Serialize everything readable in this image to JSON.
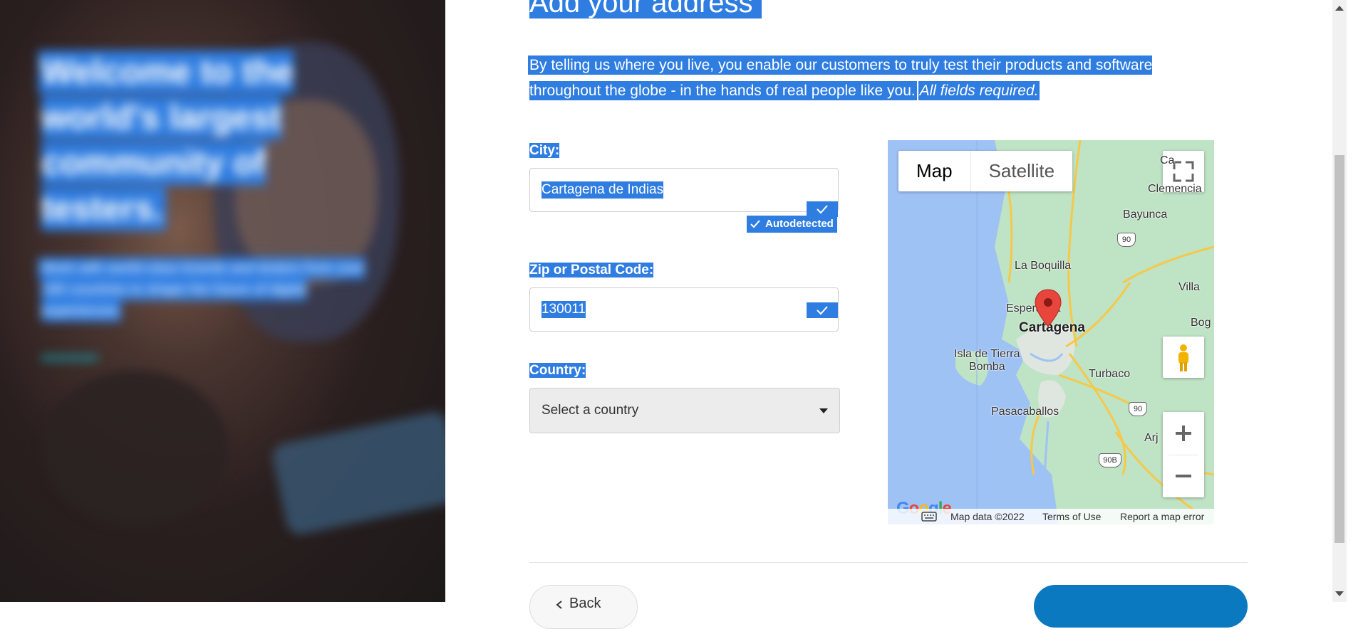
{
  "hero": {
    "title": "Welcome to the world's largest community of testers.",
    "subtitle": "Work with world-class brands and testers from over 190 countries to shape the future of digital experiences"
  },
  "page": {
    "heading": "Add your address",
    "intro": "By telling us where you live, you enable our customers to truly test their products and software throughout the globe - in the hands of real people like you.",
    "intro_emphasis": "All fields required."
  },
  "form": {
    "city_label": "City:",
    "city_value": "Cartagena de Indias",
    "autodetected": "Autodetected",
    "zip_label": "Zip or Postal Code:",
    "zip_value": "130011",
    "country_label": "Country:",
    "country_placeholder": "Select a country"
  },
  "map": {
    "tab_map": "Map",
    "tab_satellite": "Satellite",
    "places": {
      "bayunca": "Bayunca",
      "la_boquilla": "La Boquilla",
      "esperanza": "Esperanza",
      "cartagena": "Cartagena",
      "isla": "Isla de Tierra\nBomba",
      "turbaco": "Turbaco",
      "pasacaballos": "Pasacaballos",
      "villa": "Villa",
      "bog": "Bog",
      "arj": "Arj",
      "clemencia": "Clemencia",
      "ca": "Ca"
    },
    "routes": [
      "90",
      "90",
      "90B"
    ],
    "footer_data": "Map data ©2022",
    "footer_terms": "Terms of Use",
    "footer_report": "Report a map error",
    "google": "Google"
  },
  "nav": {
    "back": "Back"
  }
}
